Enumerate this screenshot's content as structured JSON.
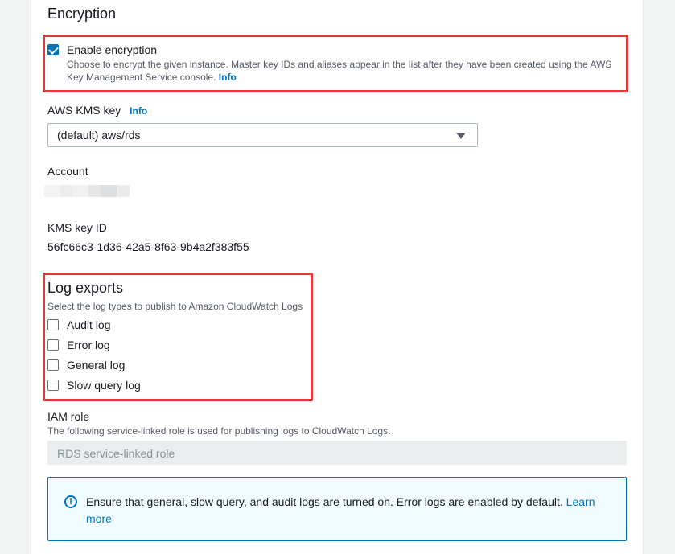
{
  "encryption": {
    "heading": "Encryption",
    "enable_label": "Enable encryption",
    "enable_checked": true,
    "enable_desc": "Choose to encrypt the given instance. Master key IDs and aliases appear in the list after they have been created using the AWS Key Management Service console.",
    "enable_info": "Info",
    "kms_key_label": "AWS KMS key",
    "kms_key_info": "Info",
    "kms_key_value": "(default) aws/rds",
    "account_label": "Account",
    "kms_key_id_label": "KMS key ID",
    "kms_key_id_value": "56fc66c3-1d36-42a5-8f63-9b4a2f383f55"
  },
  "log_exports": {
    "heading": "Log exports",
    "desc": "Select the log types to publish to Amazon CloudWatch Logs",
    "options": [
      {
        "label": "Audit log",
        "checked": false
      },
      {
        "label": "Error log",
        "checked": false
      },
      {
        "label": "General log",
        "checked": false
      },
      {
        "label": "Slow query log",
        "checked": false
      }
    ]
  },
  "iam_role": {
    "label": "IAM role",
    "desc": "The following service-linked role is used for publishing logs to CloudWatch Logs.",
    "value": "RDS service-linked role"
  },
  "alert": {
    "text": "Ensure that general, slow query, and audit logs are turned on. Error logs are enabled by default.",
    "link": "Learn more",
    "icon": "info-icon"
  },
  "colors": {
    "accent": "#0073bb",
    "highlight": "#e0393e"
  }
}
